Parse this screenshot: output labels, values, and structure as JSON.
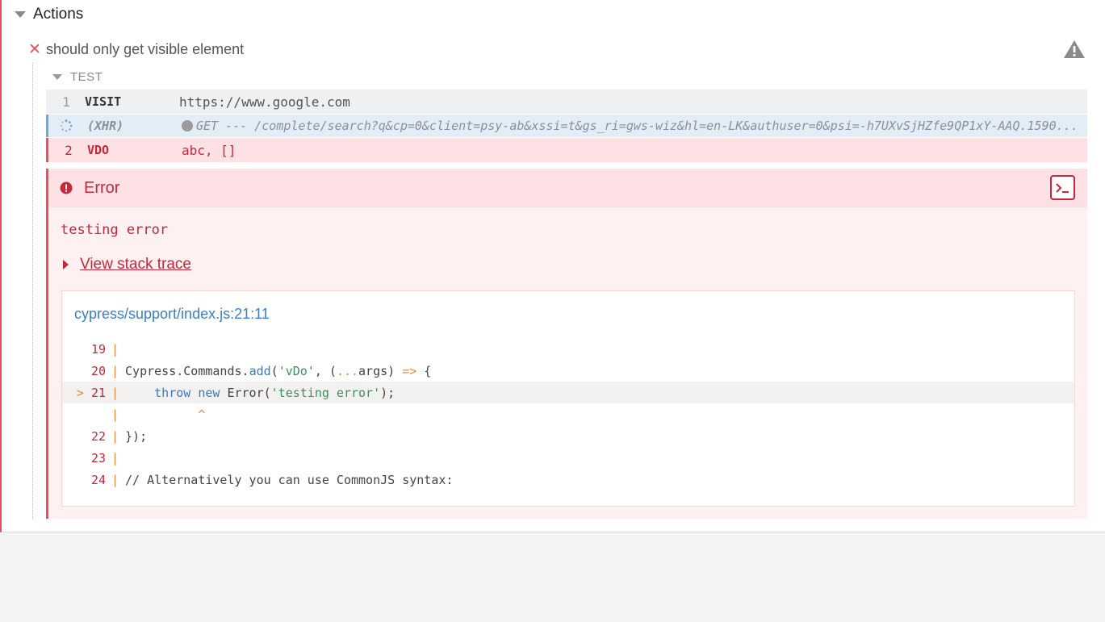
{
  "suite": {
    "title": "Actions"
  },
  "test": {
    "title": "should only get visible element",
    "status_icon": "fail-x",
    "warning_icon": "warning-triangle-icon"
  },
  "hook": {
    "title": "TEST"
  },
  "commands": [
    {
      "number": "1",
      "name": "VISIT",
      "message": "https://www.google.com"
    },
    {
      "number": "",
      "name": "(XHR)",
      "message": "GET --- /complete/search?q&cp=0&client=psy-ab&xssi=t&gs_ri=gws-wiz&hl=en-LK&authuser=0&psi=-h7UXvSjHZfe9QP1xY-AAQ.1590..."
    },
    {
      "number": "2",
      "name": "VDO",
      "message": "abc, []"
    }
  ],
  "error": {
    "title": "Error",
    "message": "testing error",
    "stack_trace_label": "View stack trace",
    "code_frame": {
      "file": "cypress/support/index.js:21:11",
      "lines": [
        {
          "num": "19",
          "prefix": "",
          "code": ""
        },
        {
          "num": "20",
          "prefix": "",
          "code": "Cypress.Commands.add('vDo', (...args) => {"
        },
        {
          "num": "21",
          "prefix": "> ",
          "code": "    throw new Error('testing error');"
        },
        {
          "num": "",
          "prefix": "",
          "code": "          ^"
        },
        {
          "num": "22",
          "prefix": "",
          "code": "});"
        },
        {
          "num": "23",
          "prefix": "",
          "code": ""
        },
        {
          "num": "24",
          "prefix": "",
          "code": "// Alternatively you can use CommonJS syntax:"
        }
      ]
    }
  },
  "colors": {
    "fail": "#e94f5f",
    "error_text": "#c6283a",
    "link": "#3a7fd0"
  }
}
